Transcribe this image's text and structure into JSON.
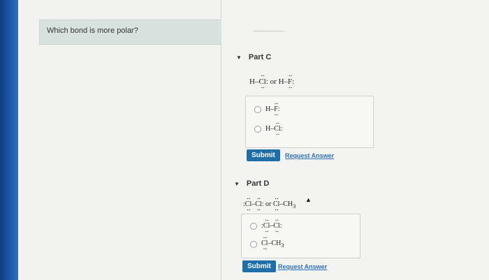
{
  "question": {
    "text": "Which bond is more polar?"
  },
  "partC": {
    "label": "Part C",
    "formula": {
      "a": "H–",
      "cl": "Cl",
      "colon": ":",
      "or": "or",
      "b": "H–",
      "f": "F",
      "colon2": ":"
    },
    "options": [
      {
        "prefix": "H–",
        "atom": "F",
        "suffix": ":"
      },
      {
        "prefix": "H–",
        "atom": "Cl",
        "suffix": ":"
      }
    ],
    "submit": "Submit",
    "request": "Request Answer"
  },
  "partD": {
    "label": "Part D",
    "formula": {
      "lead": ":",
      "cl1": "Cl",
      "dash": "–",
      "cl2": "Cl",
      "colon": ":",
      "or": "or",
      "cl3": "Cl",
      "rest": "–CH",
      "sub": "3"
    },
    "options": [
      {
        "lead": ":",
        "a": "Cl",
        "dash": "–",
        "b": "Cl",
        "suffix": ":"
      },
      {
        "a": "Cl",
        "rest": "–CH",
        "sub": "3"
      }
    ],
    "submit": "Submit",
    "request": "Request Answer"
  }
}
